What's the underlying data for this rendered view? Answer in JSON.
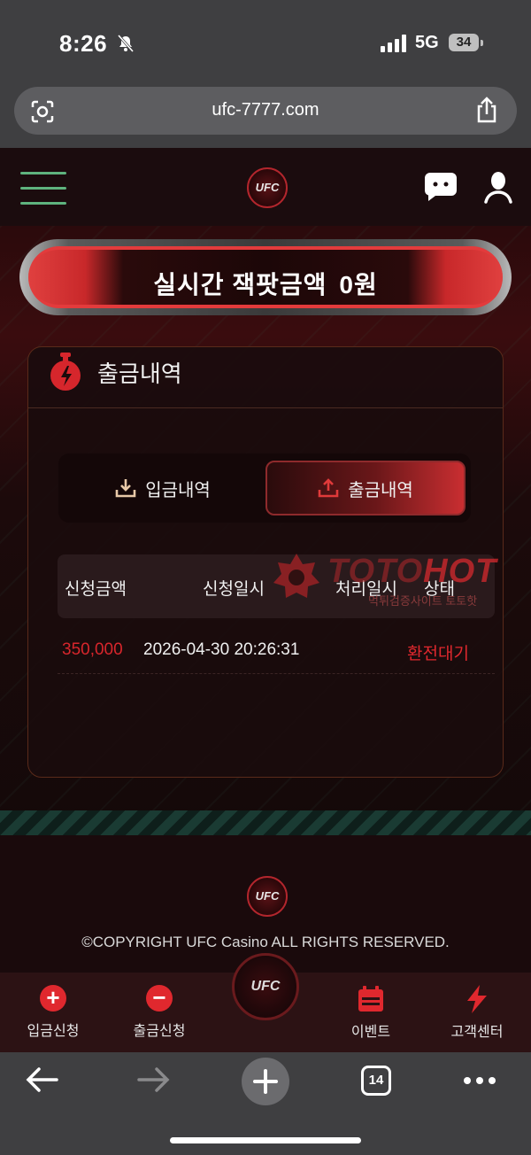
{
  "status_bar": {
    "time": "8:26",
    "network": "5G",
    "battery": "34"
  },
  "browser": {
    "url": "ufc-7777.com",
    "tab_count": "14"
  },
  "header": {
    "logo_text": "UFC"
  },
  "jackpot": {
    "label": "실시간 잭팟금액",
    "amount": "0원"
  },
  "panel": {
    "title": "출금내역",
    "tabs": [
      {
        "label": "입금내역",
        "active": false
      },
      {
        "label": "출금내역",
        "active": true
      }
    ],
    "table": {
      "columns": [
        "신청금액",
        "신청일시",
        "처리일시",
        "상태"
      ],
      "rows": [
        {
          "amount": "350,000",
          "requested_at": "2026-04-30 20:26:31",
          "processed_at": "",
          "status": "환전대기"
        }
      ]
    }
  },
  "watermark": {
    "text_a": "TOTO",
    "text_b": "HOT",
    "sub": "먹튀검증사이트 토토핫"
  },
  "footer": {
    "copyright": "©COPYRIGHT UFC Casino ALL RIGHTS RESERVED."
  },
  "bottom_nav": [
    {
      "label": "입금신청",
      "icon": "plus-circle-icon"
    },
    {
      "label": "출금신청",
      "icon": "minus-circle-icon"
    },
    {
      "label": "이벤트",
      "icon": "calendar-icon"
    },
    {
      "label": "고객센터",
      "icon": "lightning-icon"
    }
  ],
  "colors": {
    "accent_red": "#e0282e",
    "menu_green": "#5fb37e",
    "background": "#120809"
  }
}
